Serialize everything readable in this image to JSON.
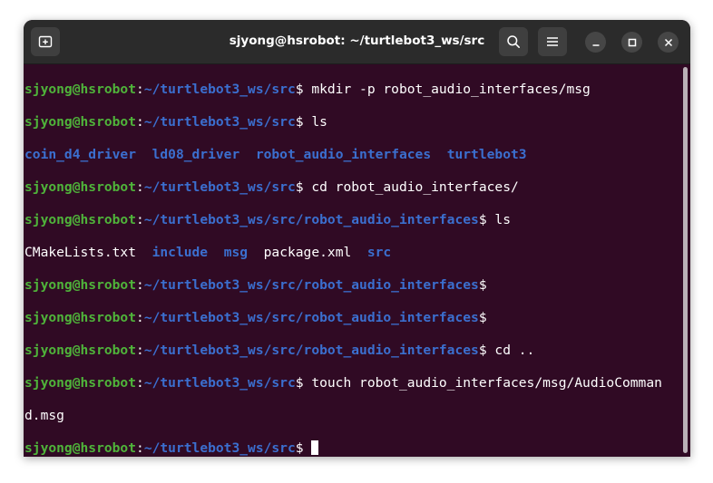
{
  "window": {
    "title": "sjyong@hsrobot: ~/turtlebot3_ws/src"
  },
  "icons": {
    "new_tab": "new-tab-icon",
    "search": "search-icon",
    "menu": "hamburger-menu-icon",
    "minimize": "minimize-icon",
    "maximize": "maximize-icon",
    "close": "close-icon"
  },
  "colors": {
    "background": "#300a24",
    "user_host": "#4fb43a",
    "path": "#3b6fcf",
    "directory": "#3b6fcf",
    "text": "#ffffff",
    "titlebar": "#2b2b2b"
  },
  "terminal": {
    "line1": {
      "user": "sjyong@hsrobot",
      "sep": ":",
      "path": "~/turtlebot3_ws/src",
      "cmd": "$ mkdir -p robot_audio_interfaces/msg"
    },
    "line2": {
      "user": "sjyong@hsrobot",
      "sep": ":",
      "path": "~/turtlebot3_ws/src",
      "cmd": "$ ls"
    },
    "line3": {
      "d1": "coin_d4_driver",
      "d2": "ld08_driver",
      "d3": "robot_audio_interfaces",
      "d4": "turtlebot3"
    },
    "line4": {
      "user": "sjyong@hsrobot",
      "sep": ":",
      "path": "~/turtlebot3_ws/src",
      "cmd": "$ cd robot_audio_interfaces/"
    },
    "line5": {
      "user": "sjyong@hsrobot",
      "sep": ":",
      "path": "~/turtlebot3_ws/src/robot_audio_interfaces",
      "cmd": "$ ls"
    },
    "line6": {
      "f1": "CMakeLists.txt",
      "d1": "include",
      "d2": "msg",
      "f2": "package.xml",
      "d3": "src"
    },
    "line7": {
      "user": "sjyong@hsrobot",
      "sep": ":",
      "path": "~/turtlebot3_ws/src/robot_audio_interfaces",
      "cmd": "$"
    },
    "line8": {
      "user": "sjyong@hsrobot",
      "sep": ":",
      "path": "~/turtlebot3_ws/src/robot_audio_interfaces",
      "cmd": "$"
    },
    "line9": {
      "user": "sjyong@hsrobot",
      "sep": ":",
      "path": "~/turtlebot3_ws/src/robot_audio_interfaces",
      "cmd": "$ cd .."
    },
    "line10": {
      "user": "sjyong@hsrobot",
      "sep": ":",
      "path": "~/turtlebot3_ws/src",
      "cmd": "$ touch robot_audio_interfaces/msg/AudioComman"
    },
    "line11": {
      "cont": "d.msg"
    },
    "line12": {
      "user": "sjyong@hsrobot",
      "sep": ":",
      "path": "~/turtlebot3_ws/src",
      "cmd": "$ "
    }
  }
}
